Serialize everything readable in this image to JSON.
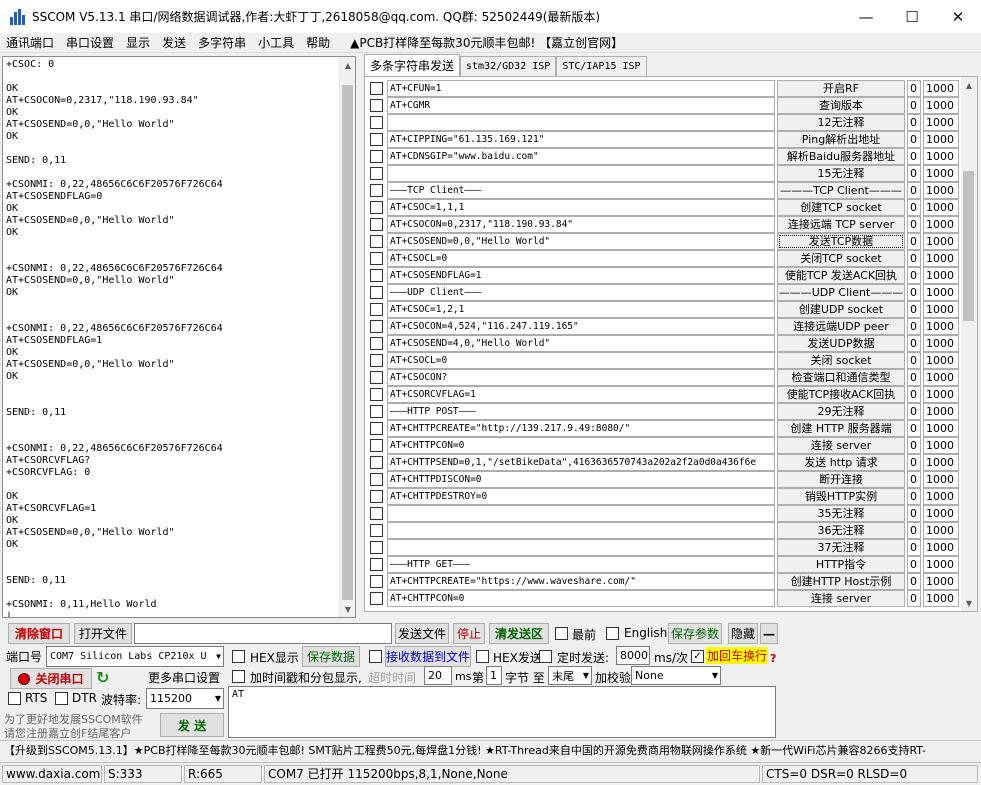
{
  "window": {
    "title": "SSCOM V5.13.1 串口/网络数据调试器,作者:大虾丁丁,2618058@qq.com. QQ群: 52502449(最新版本)",
    "minimize": "—",
    "maximize": "☐",
    "close": "✕"
  },
  "menu": {
    "items": [
      "通讯端口",
      "串口设置",
      "显示",
      "发送",
      "多字符串",
      "小工具",
      "帮助"
    ],
    "promo": "▲PCB打样降至每款30元顺丰包邮! 【嘉立创官网】"
  },
  "receive": {
    "text": "+CSOC: 0\n\nOK\nAT+CSOCON=0,2317,\"118.190.93.84\"\nOK\nAT+CSOSEND=0,0,\"Hello World\"\nOK\n\nSEND: 0,11\n\n+CSONMI: 0,22,48656C6C6F20576F726C64\nAT+CSOSENDFLAG=0\nOK\nAT+CSOSEND=0,0,\"Hello World\"\nOK\n\n\n+CSONMI: 0,22,48656C6C6F20576F726C64\nAT+CSOSEND=0,0,\"Hello World\"\nOK\n\n\n+CSONMI: 0,22,48656C6C6F20576F726C64\nAT+CSOSENDFLAG=1\nOK\nAT+CSOSEND=0,0,\"Hello World\"\nOK\n\n\nSEND: 0,11\n\n\n+CSONMI: 0,22,48656C6C6F20576F726C64\nAT+CSORCVFLAG?\n+CSORCVFLAG: 0\n\nOK\nAT+CSORCVFLAG=1\nOK\nAT+CSOSEND=0,0,\"Hello World\"\nOK\n\n\nSEND: 0,11\n\n+CSONMI: 0,11,Hello World\n|"
  },
  "tabs": [
    "多条字符串发送",
    "stm32/GD32 ISP",
    "STC/IAP15 ISP"
  ],
  "rows": [
    {
      "cmd": "AT+CFUN=1",
      "label": "开启RF",
      "order": "0",
      "delay": "1000"
    },
    {
      "cmd": "AT+CGMR",
      "label": "查询版本",
      "order": "0",
      "delay": "1000"
    },
    {
      "cmd": "",
      "label": "12无注释",
      "order": "0",
      "delay": "1000"
    },
    {
      "cmd": "AT+CIPPING=\"61.135.169.121\"",
      "label": "Ping解析出地址",
      "order": "0",
      "delay": "1000"
    },
    {
      "cmd": "AT+CDNSGIP=\"www.baidu.com\"",
      "label": "解析Baidu服务器地址",
      "order": "0",
      "delay": "1000"
    },
    {
      "cmd": "",
      "label": "15无注释",
      "order": "0",
      "delay": "1000"
    },
    {
      "cmd": "———TCP Client———",
      "label": "———TCP Client———",
      "order": "0",
      "delay": "1000"
    },
    {
      "cmd": "AT+CSOC=1,1,1",
      "label": "创建TCP socket",
      "order": "0",
      "delay": "1000"
    },
    {
      "cmd": "AT+CSOCON=0,2317,\"118.190.93.84\"",
      "label": "连接远端 TCP server",
      "order": "0",
      "delay": "1000"
    },
    {
      "cmd": "AT+CSOSEND=0,0,\"Hello World\"",
      "label": "发送TCP数据",
      "order": "0",
      "delay": "1000"
    },
    {
      "cmd": "AT+CSOCL=0",
      "label": "关闭TCP socket",
      "order": "0",
      "delay": "1000"
    },
    {
      "cmd": "AT+CSOSENDFLAG=1",
      "label": "使能TCP 发送ACK回执",
      "order": "0",
      "delay": "1000"
    },
    {
      "cmd": "———UDP Client———",
      "label": "———UDP Client———",
      "order": "0",
      "delay": "1000"
    },
    {
      "cmd": "AT+CSOC=1,2,1",
      "label": "创建UDP socket",
      "order": "0",
      "delay": "1000"
    },
    {
      "cmd": "AT+CSOCON=4,524,\"116.247.119.165\"",
      "label": "连接远端UDP peer",
      "order": "0",
      "delay": "1000"
    },
    {
      "cmd": "AT+CSOSEND=4,0,\"Hello World\"",
      "label": "发送UDP数据",
      "order": "0",
      "delay": "1000"
    },
    {
      "cmd": "AT+CSOCL=0",
      "label": "关闭 socket",
      "order": "0",
      "delay": "1000"
    },
    {
      "cmd": "AT+CSOCON?",
      "label": "检查端口和通信类型",
      "order": "0",
      "delay": "1000"
    },
    {
      "cmd": "AT+CSORCVFLAG=1",
      "label": "使能TCP接收ACK回执",
      "order": "0",
      "delay": "1000"
    },
    {
      "cmd": "———HTTP POST———",
      "label": "29无注释",
      "order": "0",
      "delay": "1000"
    },
    {
      "cmd": "AT+CHTTPCREATE=\"http://139.217.9.49:8080/\"",
      "label": "创建 HTTP 服务器端",
      "order": "0",
      "delay": "1000"
    },
    {
      "cmd": "AT+CHTTPCON=0",
      "label": "连接 server",
      "order": "0",
      "delay": "1000"
    },
    {
      "cmd": "AT+CHTTPSEND=0,1,\"/setBikeData\",4163636570743a202a2f2a0d0a436f6e",
      "label": "发送 http 请求",
      "order": "0",
      "delay": "1000"
    },
    {
      "cmd": "AT+CHTTPDISCON=0",
      "label": "断开连接",
      "order": "0",
      "delay": "1000"
    },
    {
      "cmd": "AT+CHTTPDESTROY=0",
      "label": "销毁HTTP实例",
      "order": "0",
      "delay": "1000"
    },
    {
      "cmd": "",
      "label": "35无注释",
      "order": "0",
      "delay": "1000"
    },
    {
      "cmd": "",
      "label": "36无注释",
      "order": "0",
      "delay": "1000"
    },
    {
      "cmd": "",
      "label": "37无注释",
      "order": "0",
      "delay": "1000"
    },
    {
      "cmd": "———HTTP GET———",
      "label": "HTTP指令",
      "order": "0",
      "delay": "1000"
    },
    {
      "cmd": "AT+CHTTPCREATE=\"https://www.waveshare.com/\"",
      "label": "创建HTTP Host示例",
      "order": "0",
      "delay": "1000"
    },
    {
      "cmd": "AT+CHTTPCON=0",
      "label": "连接 server",
      "order": "0",
      "delay": "1000"
    }
  ],
  "toolbar": {
    "clear_window": "清除窗口",
    "open_file": "打开文件",
    "file_path": "",
    "send_file": "发送文件",
    "stop": "停止",
    "clear_send": "清发送区",
    "topmost": "最前",
    "english": "English",
    "save_params": "保存参数",
    "expand": "隐藏",
    "minus": "—"
  },
  "port": {
    "port_label": "端口号",
    "port_value": "COM7 Silicon Labs CP210x U",
    "more_settings": "更多串口设置",
    "close_port": "关闭串口",
    "rts": "RTS",
    "dtr": "DTR",
    "baud_label": "波特率:",
    "baud_value": "115200"
  },
  "options": {
    "hex_display": "HEX显示",
    "save_data": "保存数据",
    "recv_to_file": "接收数据到文件",
    "hex_send": "HEX发送",
    "timed_send": "定时发送:",
    "interval": "8000",
    "interval_unit": "ms/次",
    "append_crlf": "加回车换行",
    "add_timestamp": "加时间戳和分包显示,",
    "timeout_label": "超时时间",
    "timeout_value": "20",
    "ms": "ms",
    "nth": "第",
    "byte_index": "1",
    "byte_label": "字节 至",
    "end": "末尾",
    "checksum_label": "加校验",
    "checksum_value": "None"
  },
  "send": {
    "text": "AT",
    "button": "发 送",
    "promo_line1": "为了更好地发展SSCOM软件",
    "promo_line2": "请您注册嘉立创F结尾客户"
  },
  "ticker": "【升级到SSCOM5.13.1】★PCB打样降至每款30元顺丰包邮! SMT贴片工程费50元,每焊盘1分钱! ★RT-Thread来自中国的开源免费商用物联网操作系统 ★新一代WiFi芯片兼容8266支持RT-",
  "status": {
    "site": "www.daxia.com",
    "sent": "S:333",
    "received": "R:665",
    "port_state": "COM7 已打开  115200bps,8,1,None,None",
    "lines": "CTS=0 DSR=0 RLSD=0"
  }
}
